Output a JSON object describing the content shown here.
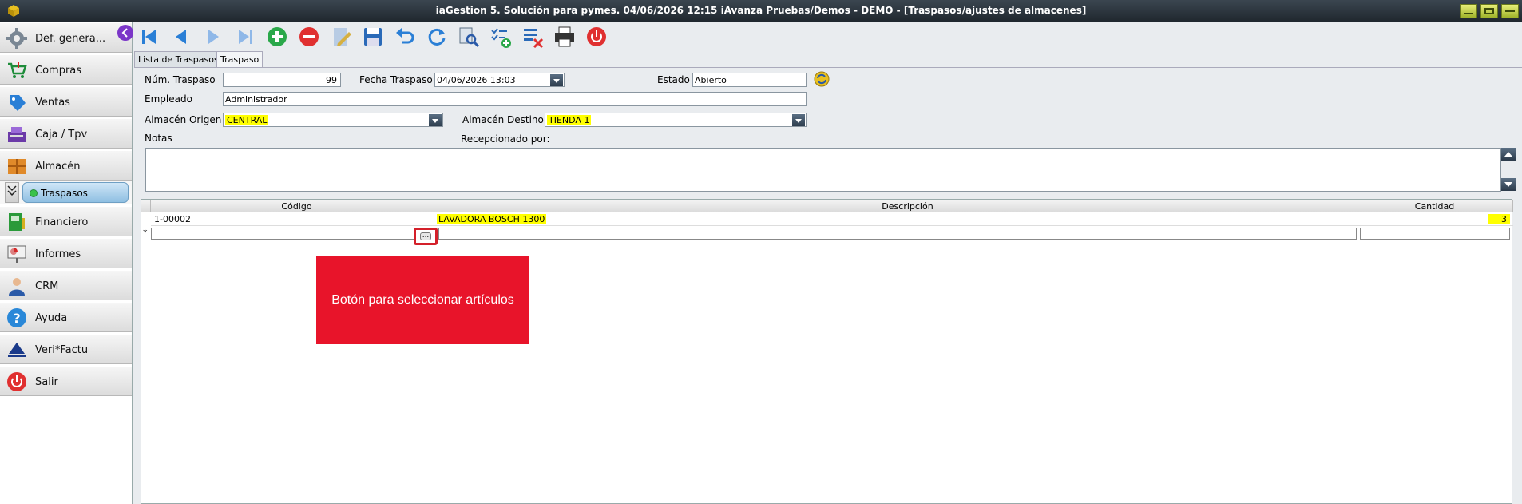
{
  "window": {
    "title": "iaGestion 5. Solución para pymes.  04/06/2026 12:15   iAvanza Pruebas/Demos - DEMO - [Traspasos/ajustes de almacenes]"
  },
  "sidebar": {
    "items": [
      {
        "label": "Def. genera...",
        "icon": "gear-icon"
      },
      {
        "label": "Compras",
        "icon": "cart-icon"
      },
      {
        "label": "Ventas",
        "icon": "sales-tag-icon"
      },
      {
        "label": "Caja / Tpv",
        "icon": "cash-register-icon"
      },
      {
        "label": "Almacén",
        "icon": "warehouse-icon"
      },
      {
        "label": "Financiero",
        "icon": "finance-icon"
      },
      {
        "label": "Informes",
        "icon": "report-chart-icon"
      },
      {
        "label": "CRM",
        "icon": "crm-person-icon"
      },
      {
        "label": "Ayuda",
        "icon": "help-icon"
      },
      {
        "label": "Veri*Factu",
        "icon": "verifactu-icon"
      },
      {
        "label": "Salir",
        "icon": "power-icon"
      }
    ],
    "subitem": "Traspasos"
  },
  "tabs": [
    "Lista de Traspasos",
    "Traspaso"
  ],
  "form": {
    "num_label": "Núm. Traspaso",
    "num_value": "99",
    "fecha_label": "Fecha Traspaso",
    "fecha_value": "04/06/2026 13:03",
    "estado_label": "Estado",
    "estado_value": "Abierto",
    "empleado_label": "Empleado",
    "empleado_value": "Administrador",
    "origen_label": "Almacén Origen",
    "origen_value": "CENTRAL",
    "destino_label": "Almacén Destino",
    "destino_value": "TIENDA 1",
    "notas_label": "Notas",
    "recepcionado_label": "Recepcionado por:"
  },
  "grid": {
    "headers": [
      "Código",
      "Descripción",
      "Cantidad"
    ],
    "rows": [
      {
        "codigo": "1-00002",
        "descripcion": "LAVADORA BOSCH 1300",
        "cantidad": "3"
      }
    ],
    "new_row_marker": "*",
    "ellipsis": "..."
  },
  "callout": "Botón para seleccionar artículos",
  "colors": {
    "highlight": "#ffff00",
    "callout": "#e8142a",
    "accent": "#7b36c8"
  }
}
